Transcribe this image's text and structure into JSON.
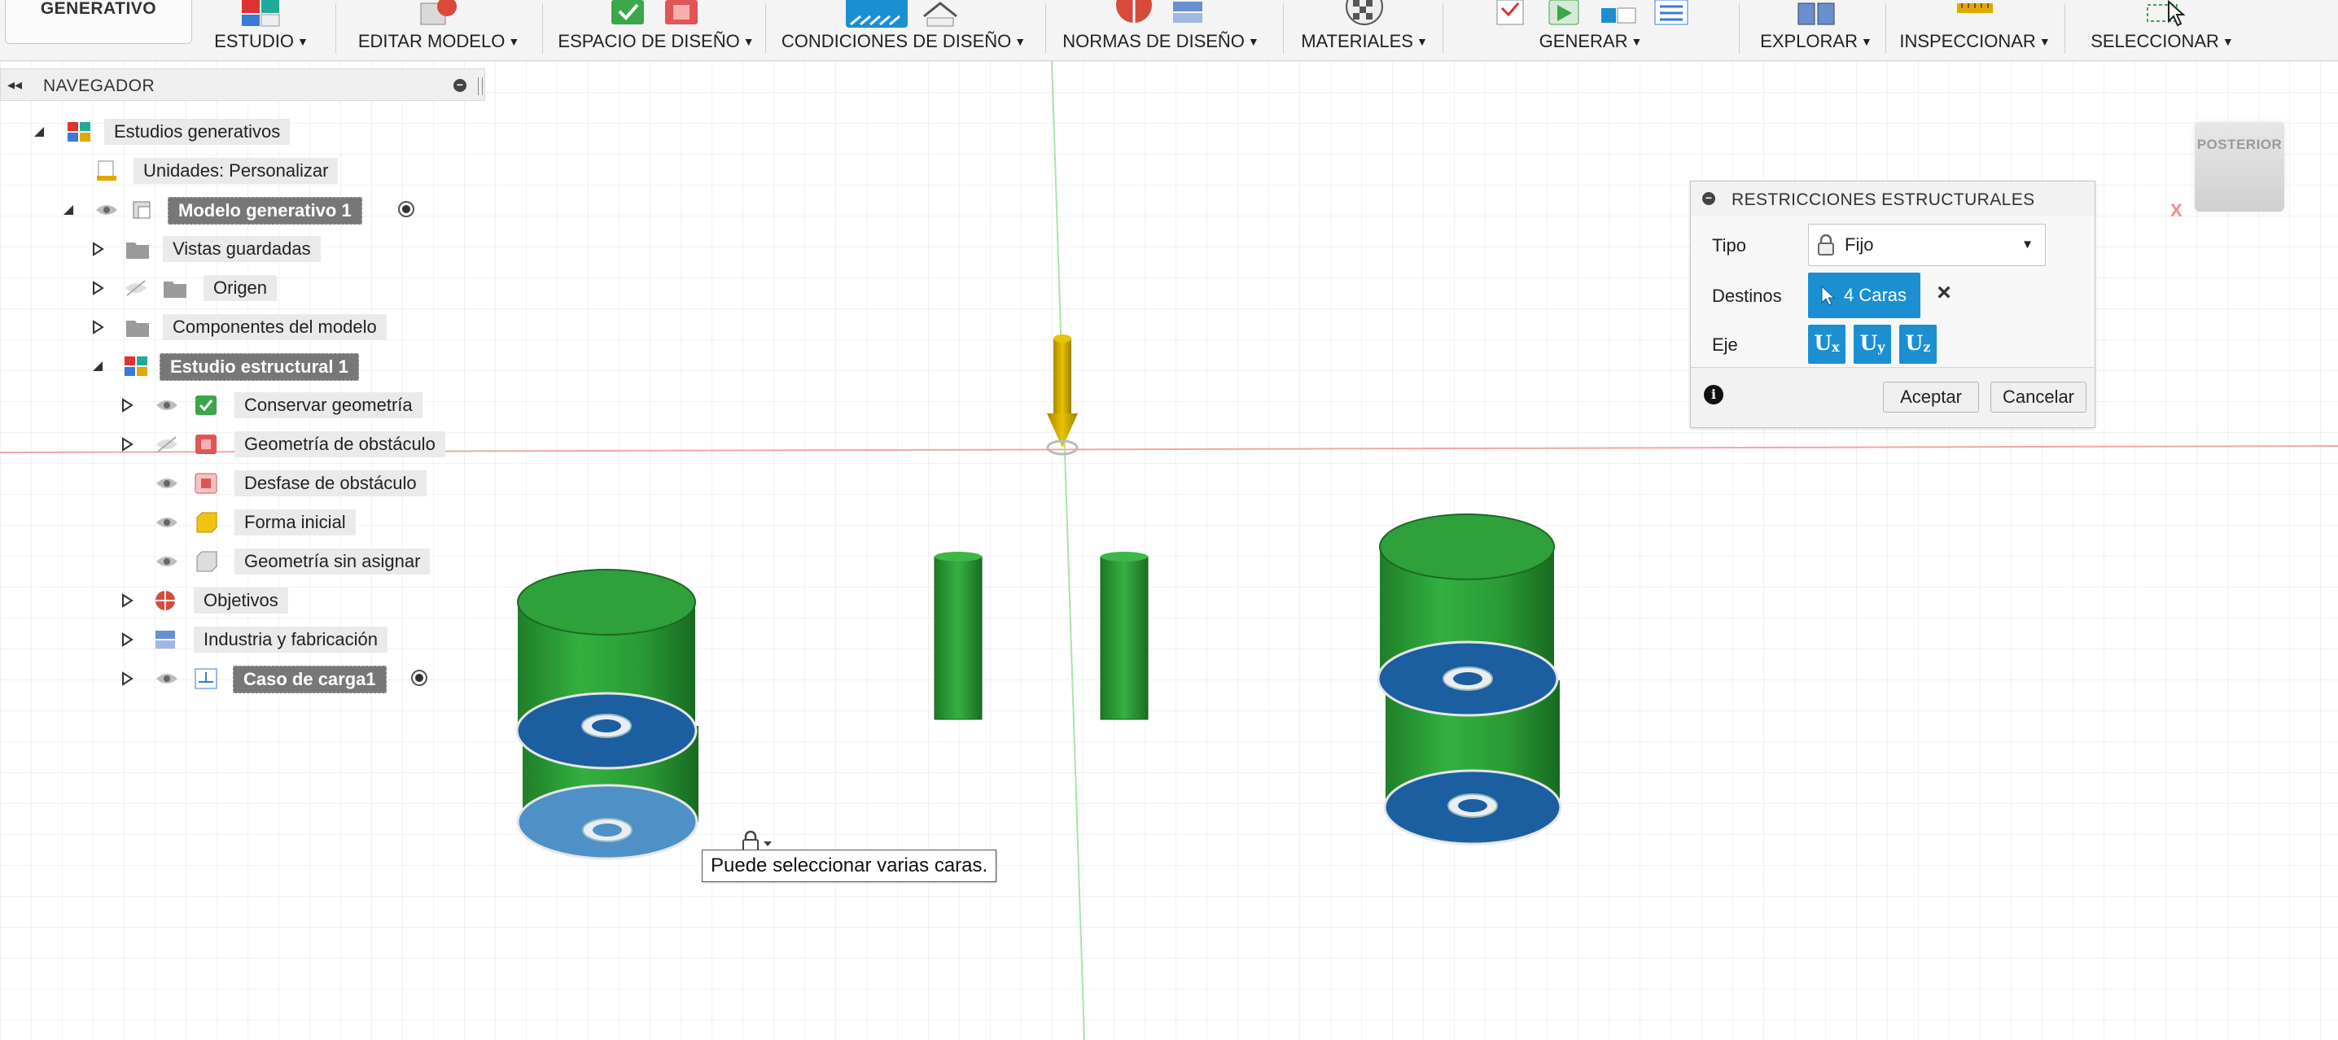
{
  "toolbar": {
    "workspace": "GENERATIVO",
    "groups": [
      {
        "label": "ESTUDIO"
      },
      {
        "label": "EDITAR MODELO"
      },
      {
        "label": "ESPACIO DE DISEÑO"
      },
      {
        "label": "CONDICIONES DE DISEÑO"
      },
      {
        "label": "NORMAS DE DISEÑO"
      },
      {
        "label": "MATERIALES"
      },
      {
        "label": "GENERAR"
      },
      {
        "label": "EXPLORAR"
      },
      {
        "label": "INSPECCIONAR"
      },
      {
        "label": "SELECCIONAR"
      }
    ]
  },
  "navigator": {
    "title": "NAVEGADOR",
    "items": [
      {
        "label": "Estudios generativos",
        "icon": "generative-studies-icon"
      },
      {
        "label": "Unidades: Personalizar",
        "icon": "document-icon"
      },
      {
        "label": "Modelo generativo 1",
        "icon": "generative-model-icon",
        "active": true
      },
      {
        "label": "Vistas guardadas",
        "icon": "folder-icon"
      },
      {
        "label": "Origen",
        "icon": "folder-icon"
      },
      {
        "label": "Componentes del modelo",
        "icon": "folder-icon"
      },
      {
        "label": "Estudio estructural 1",
        "icon": "structural-study-icon",
        "active": true
      },
      {
        "label": "Conservar geometría",
        "icon": "preserve-geometry-icon"
      },
      {
        "label": "Geometría de obstáculo",
        "icon": "obstacle-geometry-icon"
      },
      {
        "label": "Desfase de obstáculo",
        "icon": "obstacle-offset-icon"
      },
      {
        "label": "Forma inicial",
        "icon": "starting-shape-icon"
      },
      {
        "label": "Geometría sin asignar",
        "icon": "unassigned-geometry-icon"
      },
      {
        "label": "Objetivos",
        "icon": "objectives-icon"
      },
      {
        "label": "Industria y fabricación",
        "icon": "manufacturing-icon"
      },
      {
        "label": "Caso de carga1",
        "icon": "load-case-icon",
        "active": true
      }
    ]
  },
  "dialog": {
    "title": "RESTRICCIONES ESTRUCTURALES",
    "type_label": "Tipo",
    "type_value": "Fijo",
    "targets_label": "Destinos",
    "targets_value": "4 Caras",
    "axis_label": "Eje",
    "axes": [
      "U",
      "U",
      "U"
    ],
    "axis_subs": [
      "x",
      "y",
      "z"
    ],
    "ok_label": "Aceptar",
    "cancel_label": "Cancelar"
  },
  "viewcube": {
    "face": "POSTERIOR",
    "axis": "X"
  },
  "tooltip": {
    "text": "Puede seleccionar varias caras."
  },
  "colors": {
    "accent": "#1b8fd2",
    "preserve_green": "#2fa83a",
    "selected_face": "#1b5fa0",
    "load_arrow": "#c9a800",
    "axis_red": "#f28a8a",
    "axis_green": "#7fd97f"
  }
}
